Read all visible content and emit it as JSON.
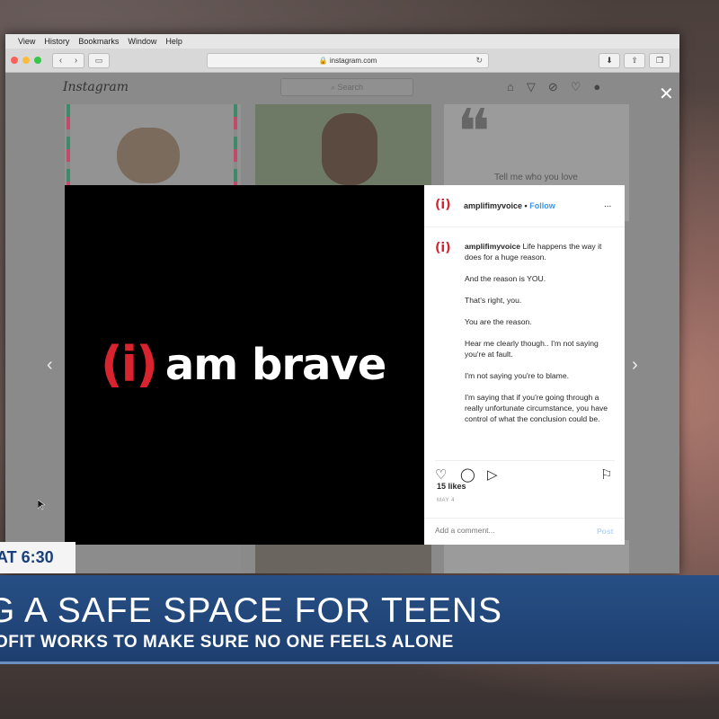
{
  "menu": [
    "View",
    "History",
    "Bookmarks",
    "Window",
    "Help"
  ],
  "browser": {
    "url": "instagram.com"
  },
  "instagram": {
    "logo": "Instagram",
    "search_placeholder": "Search",
    "bg_quote": "Tell me who you love"
  },
  "post": {
    "image_logo": "(i)",
    "image_text": "am brave",
    "username": "amplifimyvoice",
    "separator": "•",
    "follow_label": "Follow",
    "more": "...",
    "caption": [
      "Life happens the way it does for a huge reason.",
      "And the reason is YOU.",
      "That's right, you.",
      "You are the reason.",
      "Hear me clearly though.. I'm not saying you're at fault.",
      "I'm not saying you're to blame.",
      "I'm saying that if you're going through a really unfortunate circumstance, you have control of what the conclusion could be."
    ],
    "likes": "15 likes",
    "date": "MAY 4",
    "comment_placeholder": "Add a comment...",
    "post_label": "Post"
  },
  "news": {
    "time": "AT 6:30",
    "headline": "G A SAFE SPACE FOR TEENS",
    "subhead": "OFIT WORKS TO MAKE SURE NO ONE FEELS ALONE"
  },
  "colors": {
    "brand_red": "#d9232e",
    "ig_blue": "#3897f0",
    "news_blue": "#274f85"
  }
}
